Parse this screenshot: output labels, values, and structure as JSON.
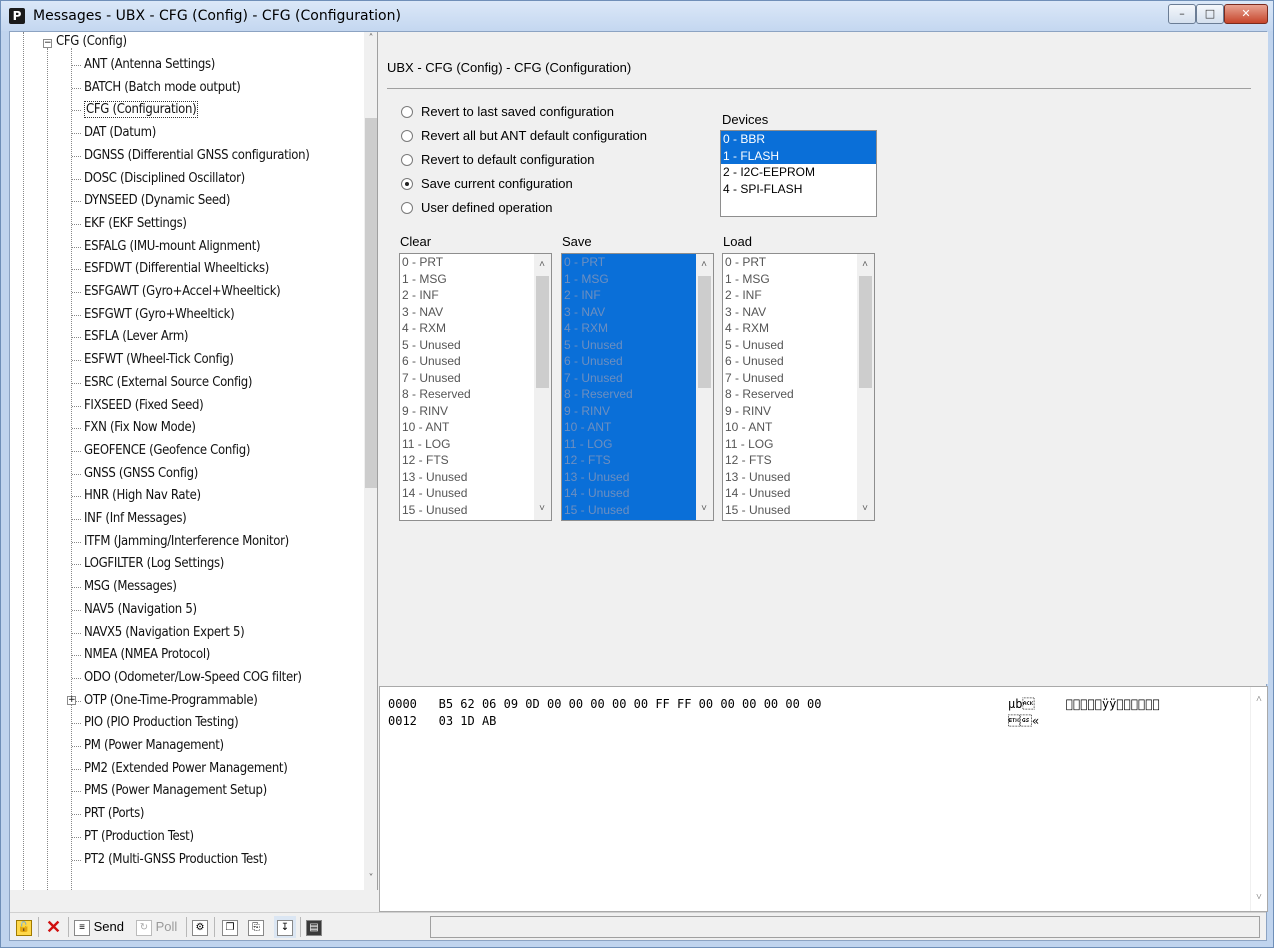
{
  "window": {
    "title": "Messages - UBX - CFG (Config) - CFG (Configuration)",
    "app_icon": "P",
    "minimize_icon": "minimize-icon",
    "maximize_icon": "maximize-icon",
    "close_icon": "close-icon"
  },
  "tree": {
    "root": "CFG (Config)",
    "items": [
      "ANT (Antenna Settings)",
      "BATCH (Batch mode output)",
      "CFG (Configuration)",
      "DAT (Datum)",
      "DGNSS (Differential GNSS configuration)",
      "DOSC (Disciplined Oscillator)",
      "DYNSEED (Dynamic Seed)",
      "EKF (EKF Settings)",
      "ESFALG (IMU-mount Alignment)",
      "ESFDWT (Differential Wheelticks)",
      "ESFGAWT (Gyro+Accel+Wheeltick)",
      "ESFGWT (Gyro+Wheeltick)",
      "ESFLA (Lever Arm)",
      "ESFWT (Wheel-Tick Config)",
      "ESRC (External Source Config)",
      "FIXSEED (Fixed Seed)",
      "FXN (Fix Now Mode)",
      "GEOFENCE (Geofence Config)",
      "GNSS (GNSS Config)",
      "HNR (High Nav Rate)",
      "INF (Inf Messages)",
      "ITFM (Jamming/Interference Monitor)",
      "LOGFILTER (Log Settings)",
      "MSG (Messages)",
      "NAV5 (Navigation 5)",
      "NAVX5 (Navigation Expert 5)",
      "NMEA (NMEA Protocol)",
      "ODO (Odometer/Low-Speed COG filter)",
      "OTP (One-Time-Programmable)",
      "PIO (PIO Production Testing)",
      "PM (Power Management)",
      "PM2 (Extended Power Management)",
      "PMS (Power Management Setup)",
      "PRT (Ports)",
      "PT (Production Test)",
      "PT2 (Multi-GNSS Production Test)"
    ],
    "selected": "CFG (Configuration)"
  },
  "pane": {
    "title": "UBX - CFG (Config) - CFG (Configuration)",
    "radios": [
      {
        "label": "Revert to last saved configuration",
        "checked": false
      },
      {
        "label": "Revert all but ANT default configuration",
        "checked": false
      },
      {
        "label": "Revert to default configuration",
        "checked": false
      },
      {
        "label": "Save current configuration",
        "checked": true
      },
      {
        "label": "User defined operation",
        "checked": false
      }
    ],
    "devices_label": "Devices",
    "devices": [
      {
        "label": "0 - BBR",
        "selected": true
      },
      {
        "label": "1 - FLASH",
        "selected": true
      },
      {
        "label": "2 - I2C-EEPROM",
        "selected": false
      },
      {
        "label": "4 - SPI-FLASH",
        "selected": false
      }
    ],
    "clear_label": "Clear",
    "save_label": "Save",
    "load_label": "Load",
    "sections": [
      "0 - PRT",
      "1 - MSG",
      "2 - INF",
      "3 - NAV",
      "4 - RXM",
      "5 - Unused",
      "6 - Unused",
      "7 - Unused",
      "8 - Reserved",
      "9 - RINV",
      "10 - ANT",
      "11 - LOG",
      "12 - FTS",
      "13 - Unused",
      "14 - Unused",
      "15 - Unused"
    ]
  },
  "hex": {
    "rows": [
      {
        "offset": "0000",
        "bytes": "B5 62 06 09 0D 00 00 00 00 00 FF FF 00 00 00 00 00 00",
        "ascii": "µb\u0006\t\r\u0000\u0000\u0000\u0000\u0000ÿÿ\u0000\u0000\u0000\u0000\u0000\u0000"
      },
      {
        "offset": "0012",
        "bytes": "03 1D AB",
        "ascii": "\u0003\u001d«"
      }
    ]
  },
  "toolbar": {
    "lock_icon": "lock-icon",
    "delete_icon": "delete-icon",
    "send_label": "Send",
    "poll_label": "Poll",
    "status_text": ""
  },
  "colors": {
    "selection": "#0a6fd8",
    "title_gradient_top": "#dbe8f8",
    "close_button": "#c6452b"
  }
}
